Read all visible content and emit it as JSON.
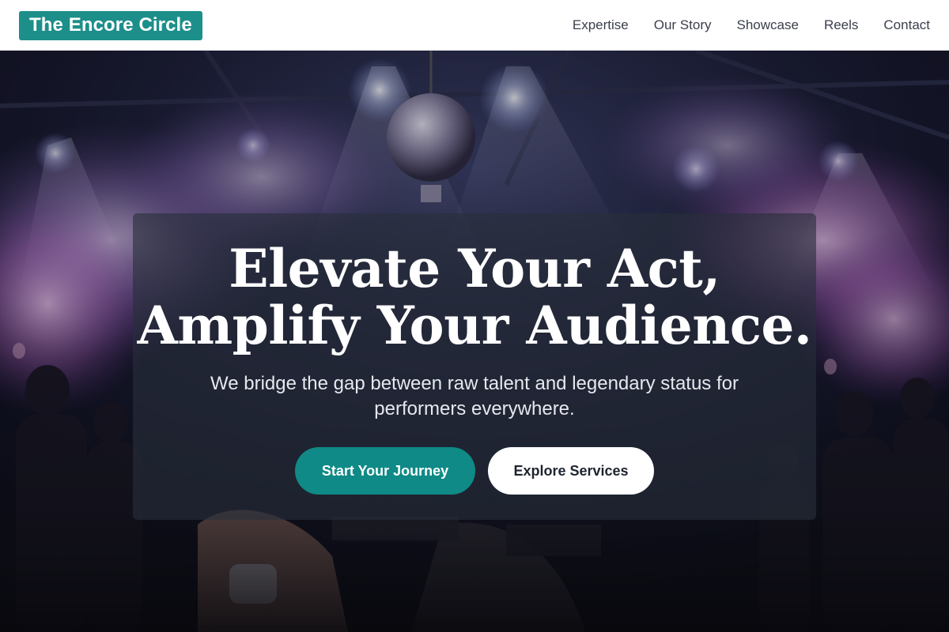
{
  "brand": {
    "name": "The Encore Circle",
    "color": "#1d8f8a"
  },
  "nav": {
    "items": [
      {
        "label": "Expertise"
      },
      {
        "label": "Our Story"
      },
      {
        "label": "Showcase"
      },
      {
        "label": "Reels"
      },
      {
        "label": "Contact"
      }
    ]
  },
  "hero": {
    "headline_line1": "Elevate Your Act,",
    "headline_line2": "Amplify Your Audience.",
    "subtitle": "We bridge the gap between raw talent and legendary status for performers everywhere.",
    "primary_cta": "Start Your Journey",
    "secondary_cta": "Explore Services",
    "accent_color": "#0f8a86"
  }
}
